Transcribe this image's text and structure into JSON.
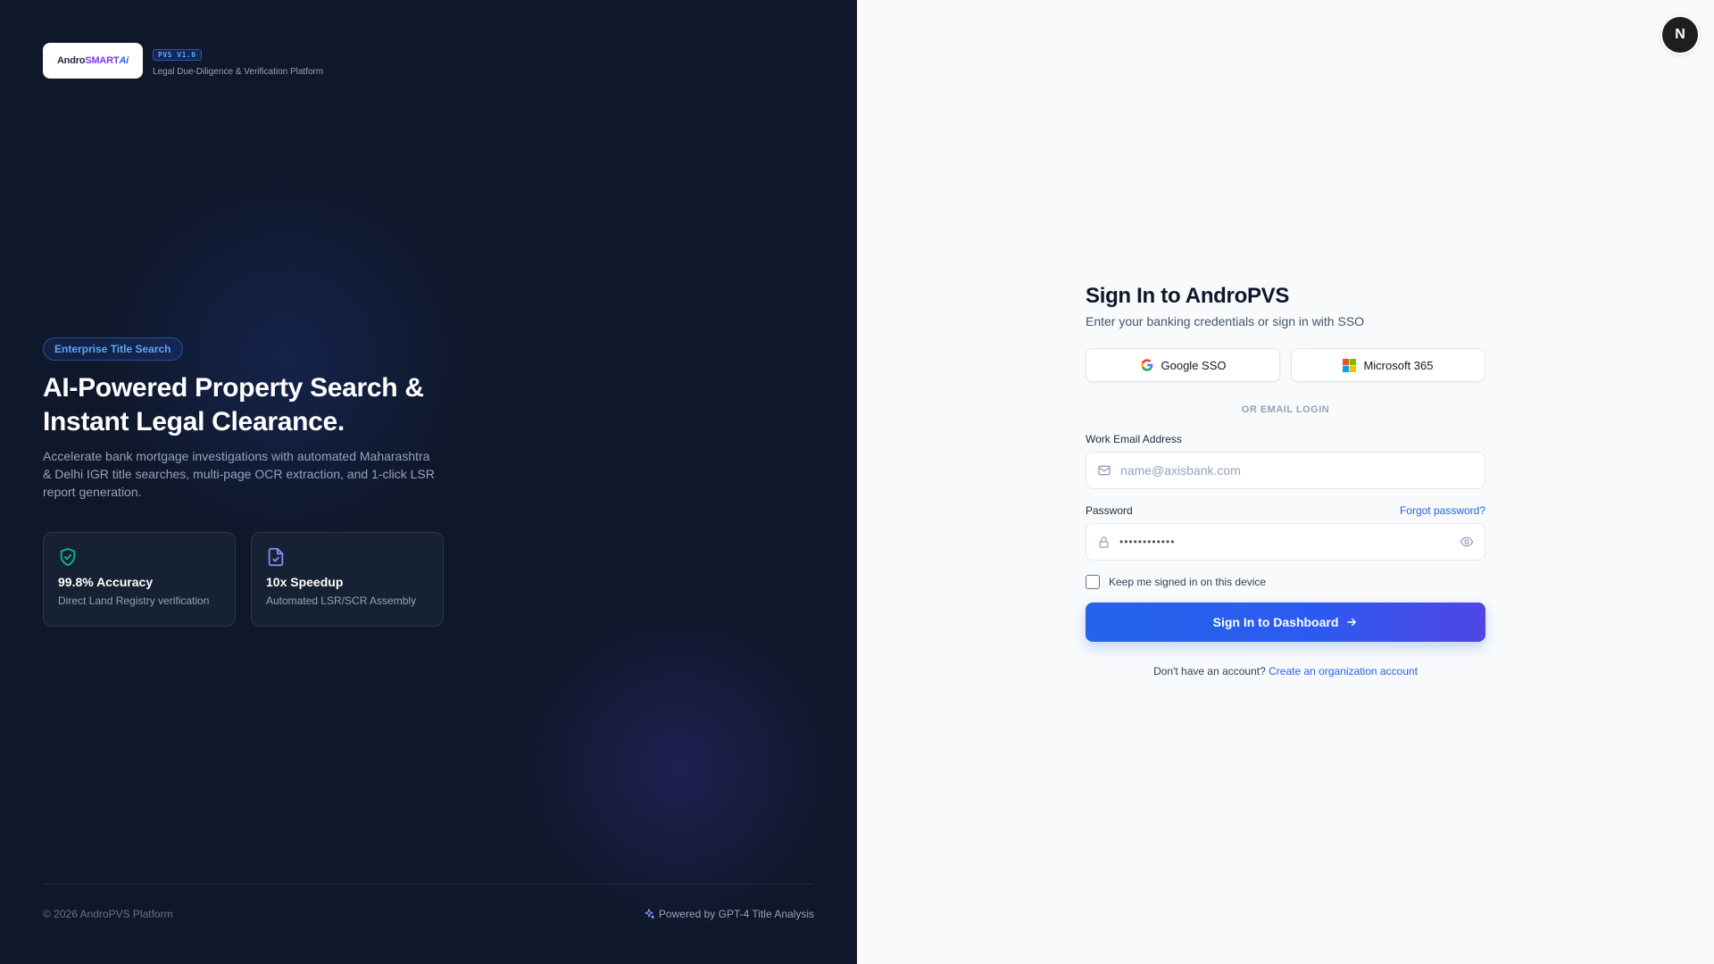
{
  "brand": {
    "logo_text_andro": "Andro",
    "logo_text_smart": "SMART",
    "logo_text_ai": "Ai",
    "version_badge": "PVS V1.0",
    "tagline": "Legal Due-Diligence & Verification Platform"
  },
  "hero": {
    "pill": "Enterprise Title Search",
    "heading_line1": "AI-Powered Property Search &",
    "heading_line2": "Instant Legal Clearance.",
    "description": "Accelerate bank mortgage investigations with automated Maharashtra & Delhi IGR title searches, multi-page OCR extraction, and 1-click LSR report generation."
  },
  "stats": [
    {
      "icon": "shield-check-icon",
      "title": "99.8% Accuracy",
      "subtitle": "Direct Land Registry verification",
      "color": "#10b981"
    },
    {
      "icon": "file-check-icon",
      "title": "10x Speedup",
      "subtitle": "Automated LSR/SCR Assembly",
      "color": "#818cf8"
    }
  ],
  "left_footer": {
    "copyright": "© 2026 AndroPVS Platform",
    "powered_by": "Powered by GPT-4 Title Analysis"
  },
  "user": {
    "avatar_initial": "N"
  },
  "form": {
    "title": "Sign In to AndroPVS",
    "subtitle": "Enter your banking credentials or sign in with SSO",
    "google_label": "Google SSO",
    "microsoft_label": "Microsoft 365",
    "divider": "OR EMAIL LOGIN",
    "email_label": "Work Email Address",
    "email_placeholder": "name@axisbank.com",
    "email_value": "",
    "password_label": "Password",
    "password_value": "••••••••••••",
    "forgot": "Forgot password?",
    "remember": "Keep me signed in on this device",
    "remember_checked": false,
    "submit": "Sign In to Dashboard",
    "signup_prompt": "Don't have an account?",
    "signup_link": "Create an organization account"
  },
  "colors": {
    "left_bg": "#0f172a",
    "accent_blue": "#2563eb",
    "accent_indigo": "#4f46e5",
    "right_bg": "#f8fafc"
  }
}
